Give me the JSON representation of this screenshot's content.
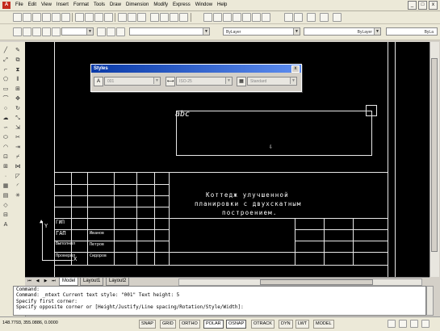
{
  "menu": {
    "items": [
      "File",
      "Edit",
      "View",
      "Insert",
      "Format",
      "Tools",
      "Draw",
      "Dimension",
      "Modify",
      "Express",
      "Window",
      "Help"
    ]
  },
  "window_buttons": [
    "_",
    "□",
    "x"
  ],
  "toolbar2": {
    "layer_combo": "ByLayer",
    "linetype_combo": "ByLayer",
    "lineweight_combo": "ByLa"
  },
  "styles_palette": {
    "title": "Styles",
    "close": "x",
    "text_style": "001",
    "dim_style": "ISO-25",
    "table_style": "Standard"
  },
  "drawing": {
    "mtext_sample": "abc",
    "title_block_text": [
      "Коттедж улучшенной",
      "планировки с двухскатным",
      "построением."
    ],
    "stamp_rows": [
      "ГИП",
      "ГАП",
      "Выполнил",
      "Проверил"
    ],
    "stamp_names": [
      "Иванов",
      "Петров",
      "Сидоров"
    ],
    "ucs_x": "X",
    "ucs_y": "Y"
  },
  "layout_tabs": [
    "Model",
    "Layout1",
    "Layout2"
  ],
  "command_lines": [
    "Command:",
    "Command: _mtext Current text style:  \"001\"  Text height:  5",
    "Specify first corner:",
    "Specify opposite corner or [Height/Justify/Line spacing/Rotation/Style/Width]:"
  ],
  "status": {
    "coords": "148.7793, 355.0886, 0.0000",
    "buttons": [
      "SNAP",
      "GRID",
      "ORTHO",
      "POLAR",
      "OSNAP",
      "OTRACK",
      "DYN",
      "LWT",
      "MODEL"
    ]
  }
}
